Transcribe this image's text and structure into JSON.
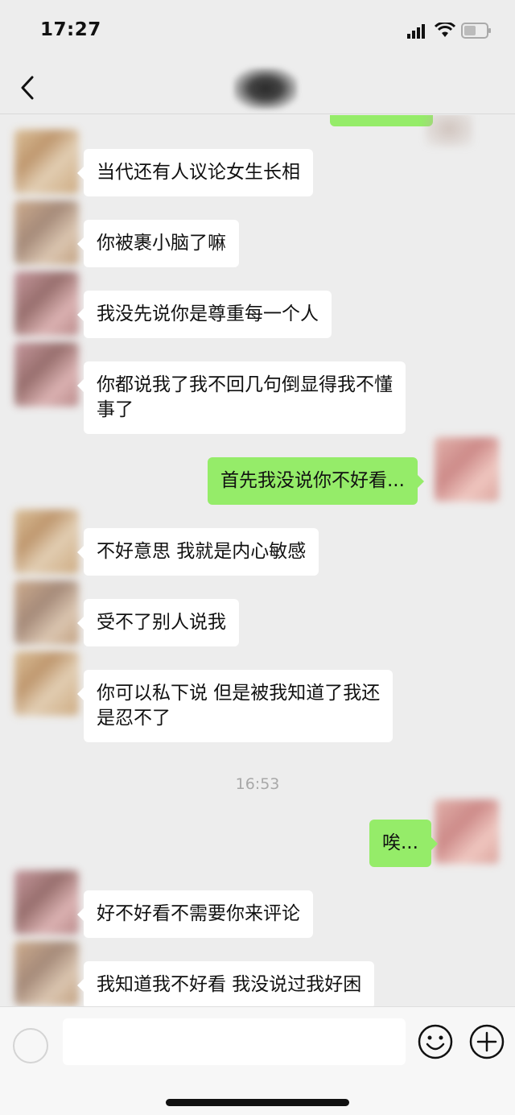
{
  "status_bar": {
    "time": "17:27",
    "icons": [
      "signal-icon",
      "wifi-icon",
      "battery-icon"
    ]
  },
  "nav": {
    "back_icon": "chevron-left-icon"
  },
  "messages": [
    {
      "side": "received",
      "text": "当代还有人议论女生长相"
    },
    {
      "side": "received",
      "text": "你被裹小脑了嘛"
    },
    {
      "side": "received",
      "text": "我没先说你是尊重每一个人"
    },
    {
      "side": "received",
      "text": "你都说我了我不回几句倒显得我不懂\n事了"
    },
    {
      "side": "sent",
      "text": "首先我没说你不好看..."
    },
    {
      "side": "received",
      "text": "不好意思 我就是内心敏感"
    },
    {
      "side": "received",
      "text": "受不了别人说我"
    },
    {
      "side": "received",
      "text": "你可以私下说 但是被我知道了我还\n是忍不了"
    },
    {
      "side": "sent",
      "text": "唉..."
    },
    {
      "side": "received",
      "text": "好不好看不需要你来评论"
    },
    {
      "side": "received",
      "text": "我知道我不好看 我没说过我好困"
    }
  ],
  "timestamp": "16:53",
  "input": {
    "value": "",
    "icons": [
      "voice-icon",
      "emoji-icon",
      "plus-icon"
    ]
  },
  "colors": {
    "background": "#ededed",
    "sent_bubble": "#95ec69",
    "received_bubble": "#ffffff"
  }
}
